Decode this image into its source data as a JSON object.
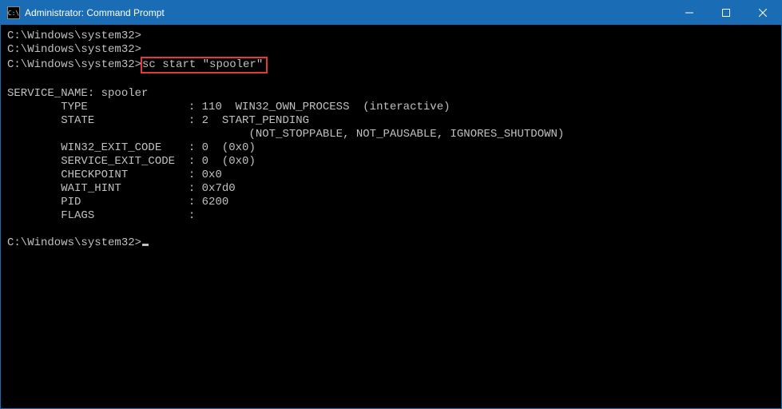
{
  "titlebar": {
    "icon_label": "C:\\",
    "title": "Administrator: Command Prompt"
  },
  "terminal": {
    "prompt": "C:\\Windows\\system32>",
    "highlighted_command": "sc start \"spooler\"",
    "service_header": "SERVICE_NAME: spooler",
    "rows": [
      {
        "label": "TYPE",
        "sep": ":",
        "value": "110  WIN32_OWN_PROCESS  (interactive)"
      },
      {
        "label": "STATE",
        "sep": ":",
        "value": "2  START_PENDING"
      },
      {
        "label": "",
        "sep": " ",
        "value": "       (NOT_STOPPABLE, NOT_PAUSABLE, IGNORES_SHUTDOWN)"
      },
      {
        "label": "WIN32_EXIT_CODE",
        "sep": ":",
        "value": "0  (0x0)"
      },
      {
        "label": "SERVICE_EXIT_CODE",
        "sep": ":",
        "value": "0  (0x0)"
      },
      {
        "label": "CHECKPOINT",
        "sep": ":",
        "value": "0x0"
      },
      {
        "label": "WAIT_HINT",
        "sep": ":",
        "value": "0x7d0"
      },
      {
        "label": "PID",
        "sep": ":",
        "value": "6200"
      },
      {
        "label": "FLAGS",
        "sep": ":",
        "value": ""
      }
    ]
  }
}
